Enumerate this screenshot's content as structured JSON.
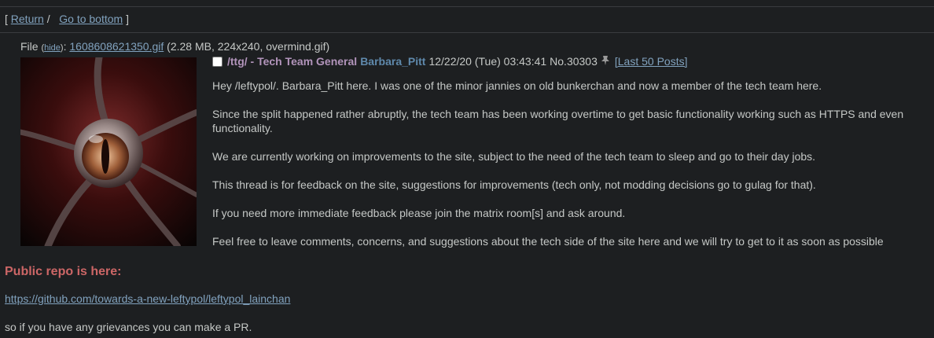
{
  "nav": {
    "open": "[",
    "return_label": "Return",
    "sep": "/",
    "bottom_label": "Go to bottom",
    "close": "]"
  },
  "file": {
    "prefix": "File",
    "hide_label": "hide",
    "filename": "1608608621350.gif",
    "meta": "(2.28 MB, 224x240, overmind.gif)"
  },
  "post": {
    "subject": "/ttg/ - Tech Team General",
    "name": "Barbara_Pitt",
    "timestamp": "12/22/20 (Tue) 03:43:41",
    "number": "No.30303",
    "last50_label": "[Last 50 Posts]",
    "paragraphs": [
      "Hey /leftypol/. Barbara_Pitt here. I was one of the minor jannies on old bunkerchan and now a member of the tech team here.",
      "Since the split happened rather abruptly, the tech team has been working overtime to get basic functionality working such as HTTPS and even",
      "functionality.",
      "We are currently working on improvements to the site, subject to the need of the tech team to sleep and go to their day jobs.",
      "This thread is for feedback on the site, suggestions for improvements (tech only, not modding decisions go to gulag for that).",
      "If you need more immediate feedback please join the matrix room[s] and ask around.",
      "Feel free to leave comments, concerns, and suggestions about the tech side of the site here and we will try to get to it as soon as possible"
    ],
    "redtext": "Public repo is here:",
    "repo_link": "https://github.com/towards-a-new-leftypol/leftypol_lainchan",
    "closing": "so if you have any grievances you can make a PR."
  },
  "colors": {
    "background": "#1d1f21",
    "text": "#c5c8c6",
    "link": "#81a2be",
    "subject": "#b294bb",
    "name": "#5f89ac",
    "redtext": "#cc6666"
  }
}
